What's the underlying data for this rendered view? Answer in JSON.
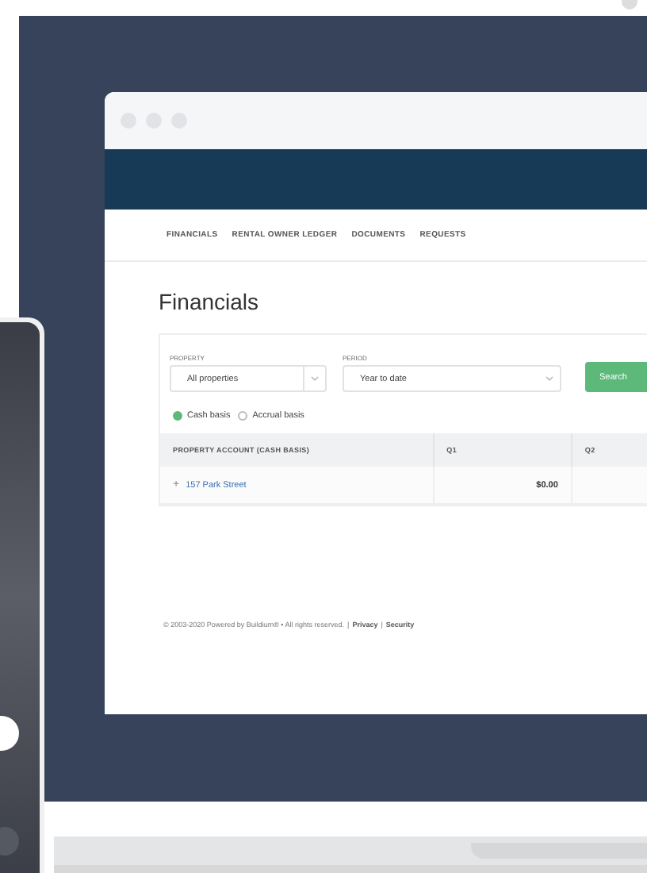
{
  "nav": [
    {
      "label": "FINANCIALS"
    },
    {
      "label": "RENTAL OWNER LEDGER"
    },
    {
      "label": "DOCUMENTS"
    },
    {
      "label": "REQUESTS"
    }
  ],
  "heading": "Financials",
  "filters": [
    {
      "label": "PROPERTY",
      "value": "All properties"
    },
    {
      "label": "PERIOD",
      "value": "Year to date"
    }
  ],
  "search_button": "Search",
  "basis": [
    {
      "label": "Cash basis",
      "selected": true
    },
    {
      "label": "Accrual basis",
      "selected": false
    }
  ],
  "table": {
    "columns": [
      "PROPERTY ACCOUNT (CASH BASIS)",
      "Q1",
      "Q2"
    ],
    "rows": [
      {
        "expand": "+",
        "account": "157 Park Street",
        "q1": "$0.00"
      }
    ]
  },
  "footer": {
    "copyright": "© 2003-2020 Powered by Buildium® • All rights reserved.",
    "links": [
      {
        "separator": "|",
        "label": "Privacy"
      },
      {
        "separator": "|",
        "label": "Security"
      }
    ]
  }
}
